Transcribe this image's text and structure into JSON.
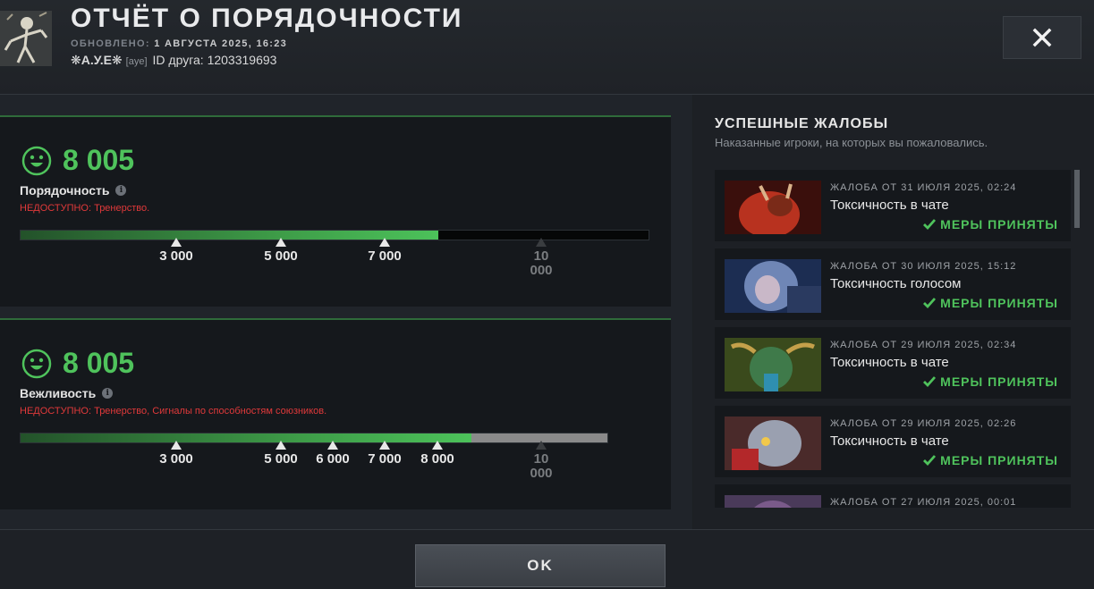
{
  "header": {
    "title": "ОТЧЁТ О ПОРЯДОЧНОСТИ",
    "updated_label": "ОБНОВЛЕНО:",
    "updated_value": "1 АВГУСТА 2025, 16:23",
    "user_name": "❋А.У.Е❋",
    "user_tag": "[aye]",
    "friend_id": "ID друга: 1203319693",
    "close_icon": "close-icon"
  },
  "panels": [
    {
      "score": "8 005",
      "name": "Порядочность",
      "unavailable": "НЕДОСТУПНО: Тренерство.",
      "progress": 0.667,
      "bar_style": "black",
      "markers": [
        {
          "label": "3 000",
          "pos": 0.25,
          "dim": false
        },
        {
          "label": "5 000",
          "pos": 0.417,
          "dim": false
        },
        {
          "label": "7 000",
          "pos": 0.583,
          "dim": false
        },
        {
          "label": "10 000",
          "pos": 0.833,
          "dim": true
        }
      ]
    },
    {
      "score": "8 005",
      "name": "Вежливость",
      "unavailable": "НЕДОСТУПНО: Тренерство, Сигналы по способностям союзников.",
      "progress": 0.72,
      "bar_style": "gray",
      "markers": [
        {
          "label": "3 000",
          "pos": 0.25,
          "dim": false
        },
        {
          "label": "5 000",
          "pos": 0.417,
          "dim": false
        },
        {
          "label": "6 000",
          "pos": 0.5,
          "dim": false
        },
        {
          "label": "7 000",
          "pos": 0.583,
          "dim": false
        },
        {
          "label": "8 000",
          "pos": 0.667,
          "dim": false
        },
        {
          "label": "10 000",
          "pos": 0.833,
          "dim": true
        }
      ]
    }
  ],
  "reports_section": {
    "title": "УСПЕШНЫЕ ЖАЛОБЫ",
    "subtitle": "Наказанные игроки, на которых вы пожаловались.",
    "items": [
      {
        "date": "ЖАЛОБА ОТ 31 ИЮЛЯ 2025, 02:24",
        "type": "Токсичность в чате",
        "status": "МЕРЫ ПРИНЯТЫ",
        "thumb_color": "#b8321f"
      },
      {
        "date": "ЖАЛОБА ОТ 30 ИЮЛЯ 2025, 15:12",
        "type": "Токсичность голосом",
        "status": "МЕРЫ ПРИНЯТЫ",
        "thumb_color": "#6f86b6"
      },
      {
        "date": "ЖАЛОБА ОТ 29 ИЮЛЯ 2025, 02:34",
        "type": "Токсичность в чате",
        "status": "МЕРЫ ПРИНЯТЫ",
        "thumb_color": "#3f7a4a"
      },
      {
        "date": "ЖАЛОБА ОТ 29 ИЮЛЯ 2025, 02:26",
        "type": "Токсичность в чате",
        "status": "МЕРЫ ПРИНЯТЫ",
        "thumb_color": "#9aa0b0"
      },
      {
        "date": "ЖАЛОБА ОТ 27 ИЮЛЯ 2025, 00:01",
        "type": "",
        "status": "",
        "thumb_color": "#7a5a8a"
      }
    ]
  },
  "footer": {
    "ok_label": "OK"
  },
  "colors": {
    "accent_green": "#4fc35c",
    "error_red": "#e0393a"
  }
}
